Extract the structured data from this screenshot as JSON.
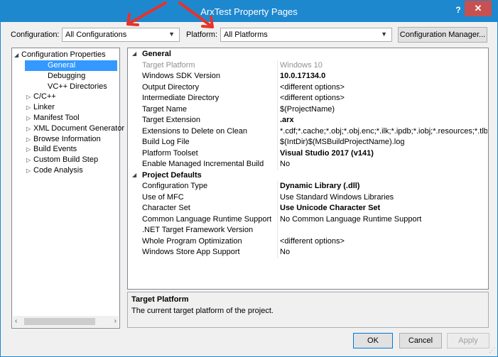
{
  "window": {
    "title": "ArxTest Property Pages",
    "help_glyph": "?",
    "close_glyph": "✕"
  },
  "toolbar": {
    "configuration_label": "Configuration:",
    "configuration_value": "All Configurations",
    "platform_label": "Platform:",
    "platform_value": "All Platforms",
    "config_manager_label": "Configuration Manager..."
  },
  "tree": {
    "root": "Configuration Properties",
    "items": [
      {
        "label": "General",
        "expandable": false,
        "selected": true
      },
      {
        "label": "Debugging",
        "expandable": false,
        "selected": false
      },
      {
        "label": "VC++ Directories",
        "expandable": false,
        "selected": false
      },
      {
        "label": "C/C++",
        "expandable": true,
        "selected": false
      },
      {
        "label": "Linker",
        "expandable": true,
        "selected": false
      },
      {
        "label": "Manifest Tool",
        "expandable": true,
        "selected": false
      },
      {
        "label": "XML Document Generator",
        "expandable": true,
        "selected": false
      },
      {
        "label": "Browse Information",
        "expandable": true,
        "selected": false
      },
      {
        "label": "Build Events",
        "expandable": true,
        "selected": false
      },
      {
        "label": "Custom Build Step",
        "expandable": true,
        "selected": false
      },
      {
        "label": "Code Analysis",
        "expandable": true,
        "selected": false
      }
    ]
  },
  "grid": {
    "general_header": "General",
    "general_rows": [
      {
        "key": "Target Platform",
        "value": "Windows 10",
        "style": "gray"
      },
      {
        "key": "Windows SDK Version",
        "value": "10.0.17134.0",
        "style": "bold"
      },
      {
        "key": "Output Directory",
        "value": "<different options>",
        "style": ""
      },
      {
        "key": "Intermediate Directory",
        "value": "<different options>",
        "style": ""
      },
      {
        "key": "Target Name",
        "value": "$(ProjectName)",
        "style": ""
      },
      {
        "key": "Target Extension",
        "value": ".arx",
        "style": "bold"
      },
      {
        "key": "Extensions to Delete on Clean",
        "value": "*.cdf;*.cache;*.obj;*.obj.enc;*.ilk;*.ipdb;*.iobj;*.resources;*.tlb;*.tli;*.t",
        "style": ""
      },
      {
        "key": "Build Log File",
        "value": "$(IntDir)$(MSBuildProjectName).log",
        "style": ""
      },
      {
        "key": "Platform Toolset",
        "value": "Visual Studio 2017 (v141)",
        "style": "bold"
      },
      {
        "key": "Enable Managed Incremental Build",
        "value": "No",
        "style": ""
      }
    ],
    "defaults_header": "Project Defaults",
    "defaults_rows": [
      {
        "key": "Configuration Type",
        "value": "Dynamic Library (.dll)",
        "style": "bold"
      },
      {
        "key": "Use of MFC",
        "value": "Use Standard Windows Libraries",
        "style": ""
      },
      {
        "key": "Character Set",
        "value": "Use Unicode Character Set",
        "style": "bold"
      },
      {
        "key": "Common Language Runtime Support",
        "value": "No Common Language Runtime Support",
        "style": ""
      },
      {
        "key": ".NET Target Framework Version",
        "value": "",
        "style": ""
      },
      {
        "key": "Whole Program Optimization",
        "value": "<different options>",
        "style": ""
      },
      {
        "key": "Windows Store App Support",
        "value": "No",
        "style": ""
      }
    ]
  },
  "description": {
    "title": "Target Platform",
    "text": "The current target platform of the project."
  },
  "buttons": {
    "ok": "OK",
    "cancel": "Cancel",
    "apply": "Apply"
  },
  "annotation": {
    "arrow_color": "#e8322a"
  }
}
